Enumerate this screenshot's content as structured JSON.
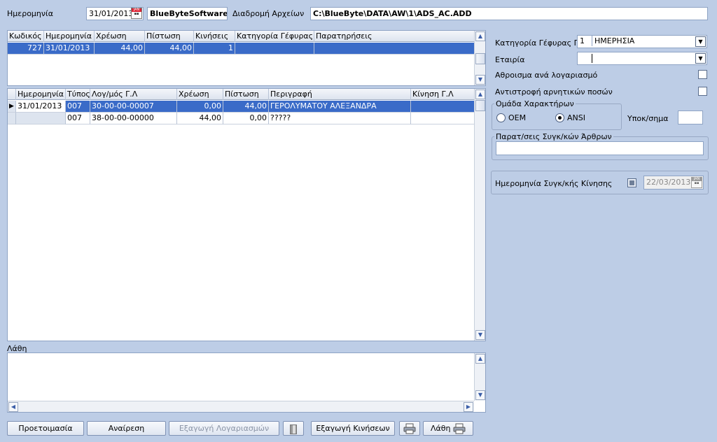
{
  "header": {
    "date_label": "Ημερομηνία",
    "date_value": "31/01/2013",
    "company_value": "BlueByteSoftware",
    "path_label": "Διαδρομή Αρχείων",
    "path_value": "C:\\BlueByte\\DATA\\AW\\1\\ADS_AC.ADD",
    "cal_text": "JAN"
  },
  "top_grid": {
    "columns": [
      "Κωδικός",
      "Ημερομηνία",
      "Χρέωση",
      "Πίστωση",
      "Κινήσεις",
      "Κατηγορία Γέφυρας ...",
      "Παρατηρήσεις"
    ],
    "rows": [
      [
        "727",
        "31/01/2013",
        "44,00",
        "44,00",
        "1",
        "",
        ""
      ]
    ]
  },
  "bottom_grid": {
    "columns": [
      "Ημερομηνία",
      "Τύπος",
      "Λογ/μός Γ.Λ",
      "Χρέωση",
      "Πίστωση",
      "Περιγραφή",
      "Κίνηση Γ.Λ"
    ],
    "rows": [
      [
        "31/01/2013",
        "007",
        "30-00-00-00007",
        "0,00",
        "44,00",
        "ΓΕΡΟΛΥΜΑΤΟΥ ΑΛΕΞΑΝΔΡΑ",
        ""
      ],
      [
        "",
        "007",
        "38-00-00-00000",
        "44,00",
        "0,00",
        "?????",
        ""
      ]
    ]
  },
  "errors": {
    "label": "Λάθη",
    "text": ""
  },
  "right_panel": {
    "bridge_category_label": "Κατηγορία Γέφυρας Γ.Λ",
    "bridge_category_code": "1",
    "bridge_category_value": "ΗΜΕΡΗΣΙΑ",
    "company_label": "Εταιρία",
    "company_value": "",
    "sum_per_account_label": "Αθροισμα ανά λογαριασμό",
    "reverse_negative_label": "Αντιστροφή αρνητικών ποσών",
    "charset_group_label": "Ομάδα Χαρακτήρων",
    "oem_label": "OEM",
    "ansi_label": "ANSI",
    "charset_selected": "ANSI",
    "candidate_label": "Υποκ/σημα",
    "candidate_value": "",
    "notes_group_label": "Παρατ/σεις Συγκ/κών Άρθρων",
    "notes_value": "",
    "sync_date_label": "Ημερομηνία Συγκ/κής Κίνησης",
    "sync_date_value": "22/03/2013"
  },
  "buttons": {
    "prepare": "Προετοιμασία",
    "cancel": "Αναίρεση",
    "export_accounts": "Εξαγωγή Λογαριασμών",
    "export_movements": "Εξαγωγή Κινήσεων",
    "errors": "Λάθη"
  }
}
